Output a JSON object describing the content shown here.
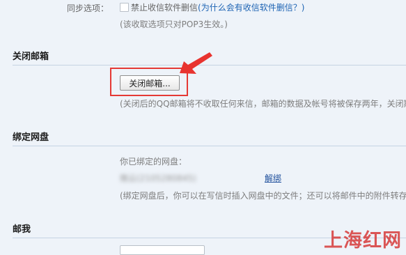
{
  "sync_options": {
    "label": "同步选项：",
    "checkbox_label": "禁止收信软件删信",
    "help_link": "(为什么会有收信软件删信？)",
    "note": "(该收取选项只对POP3生效。)"
  },
  "close_mailbox": {
    "heading": "关闭邮箱",
    "button_label": "关闭邮箱...",
    "note": "(关闭后的QQ邮箱将不收取任何来信，邮箱的数据及帐号将被保存两年，关闭期"
  },
  "cloud_disk": {
    "heading": "绑定网盘",
    "bound_label": "你已绑定的网盘：",
    "bound_value": "微云(2105280845)",
    "unbind_link": "解绑",
    "note": "(绑定网盘后，你可以在写信时插入网盘中的文件；还可以将邮件中的附件转存"
  },
  "mail_me": {
    "heading": "邮我"
  },
  "watermark": "上海红网"
}
